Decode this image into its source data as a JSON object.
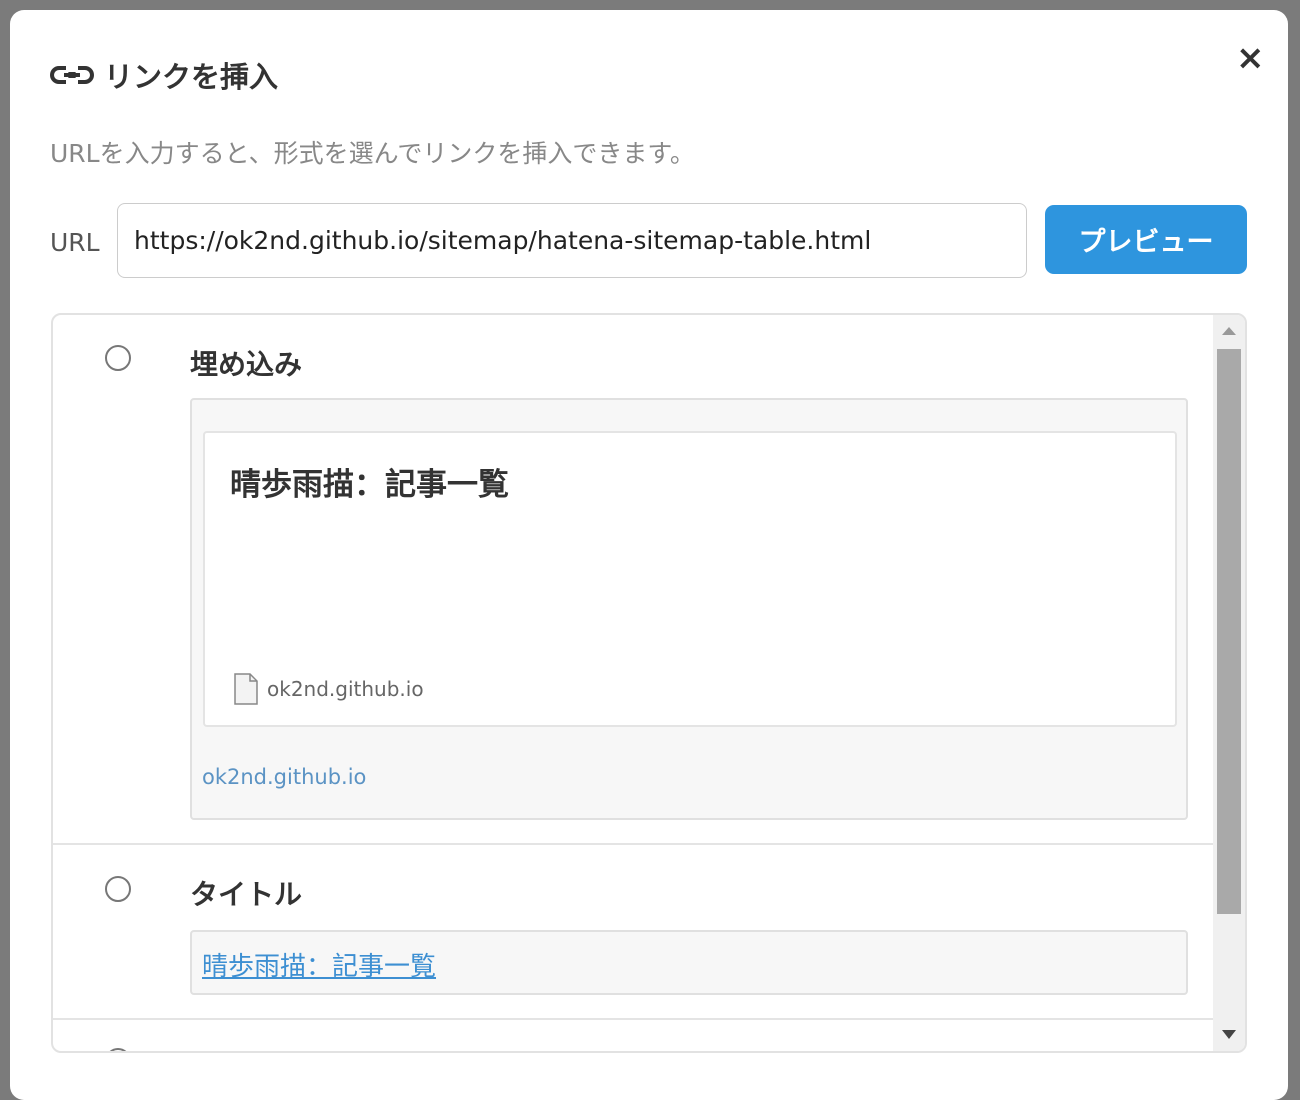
{
  "dialog": {
    "title": "リンクを挿入",
    "close_label": "×",
    "description": "URLを入力すると、形式を選んでリンクを挿入できます。",
    "url_label": "URL",
    "url_value": "https://ok2nd.github.io/sitemap/hatena-sitemap-table.html",
    "preview_button": "プレビュー"
  },
  "options": [
    {
      "label": "埋め込み",
      "card_title": "晴歩雨描：記事一覧",
      "card_domain": "ok2nd.github.io",
      "link": "ok2nd.github.io",
      "selected": false
    },
    {
      "label": "タイトル",
      "title_link": "晴歩雨描：記事一覧",
      "selected": false
    }
  ],
  "colors": {
    "accent": "#2e95de",
    "link": "#3d8fd2"
  }
}
